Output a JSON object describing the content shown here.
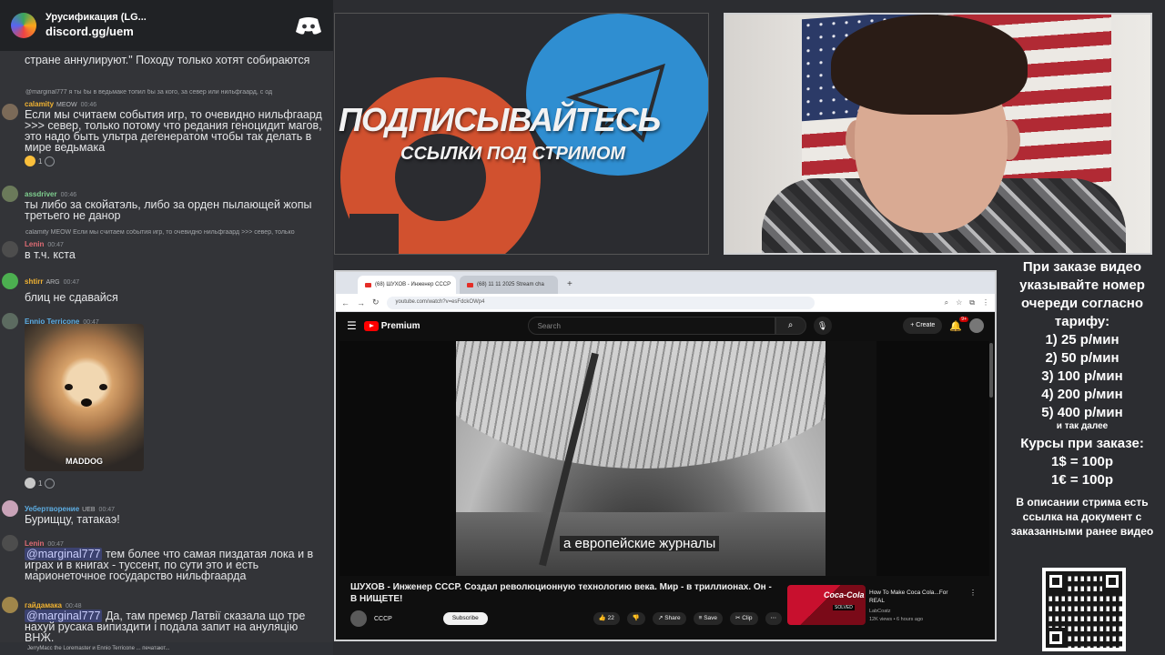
{
  "discord": {
    "server_name": "Урусификация (LG...",
    "invite": "discord.gg/uem",
    "messages": [
      {
        "text": "стране аннулируют.\" Походу только хотят собираются"
      },
      {
        "reply": "@marginal777 я ты бы в ведьмаке топил бы за кого, за север или нильфгаард, с од",
        "user": "calamity",
        "badge": "MEOW",
        "time": "00:46",
        "text": "Если мы считаем события игр, то очевидно нильфгаард >>> север, только потому что редания геноцидит магов, это надо быть ультра дегенератом чтобы так делать в мире ведьмака",
        "reaction": "1"
      },
      {
        "user": "assdriver",
        "time": "00:46",
        "text": "ты либо за скойатэль, либо за орден пылающей жопы третьего не данор"
      },
      {
        "reply": "calamity MEOW Если мы считаем события игр, то очевидно нильфгаард >>> север, только",
        "user": "Lenin",
        "time": "00:47",
        "text": "в т.ч. кста"
      },
      {
        "user": "shtirr",
        "badge": "ARG",
        "time": "00:47",
        "text": "блиц не сдавайся"
      },
      {
        "user": "Ennio Terricone",
        "time": "00:47",
        "caption": "MADDOG",
        "reaction": "1"
      },
      {
        "user": "Уебертворение",
        "badge": "UEB",
        "time": "00:47",
        "text": "Бурищцу, татакаэ!"
      },
      {
        "user": "Lenin",
        "time": "00:47",
        "mention": "@marginal777",
        "text": " тем более что самая пиздатая лока и в играх и в книгах - туссент, по сути это и есть марионеточное государство нильфгаарда"
      },
      {
        "user": "гайдамака",
        "time": "00:48",
        "mention": "@marginal777",
        "text": " Да, там премєр Латвії сказала що тре нахуй русака випиздити і подала запит на ануляцію ВНЖ."
      }
    ],
    "typing": "JerryMacc the Loremaster и Ennio Terricone ... печатают..."
  },
  "banner": {
    "title": "ПОДПИСЫВАЙТЕСЬ",
    "subtitle": "ССЫЛКИ ПОД СТРИМОМ"
  },
  "browser": {
    "tabs": [
      {
        "label": "(68) ШУХОВ - Инженер СССР"
      },
      {
        "label": "(68) 11 11 2025 Stream cha"
      }
    ],
    "new_tab": "+",
    "url": "youtube.com/watch?v=esFdckOWp4"
  },
  "youtube": {
    "logo": "Premium",
    "search_placeholder": "Search",
    "create": "Create",
    "notifications": "9+",
    "subtitle": "а европейские журналы",
    "video_title": "ШУХОВ - Инженер СССР. Создал революционную технологию века. Мир - в триллионах. Он - В НИЩЕТЕ!",
    "channel": "СССР",
    "subscribe": "Subscribe",
    "likes": "22",
    "share": "Share",
    "save": "Save",
    "clip": "Clip",
    "rec": {
      "thumb_text": "Coca-Cola",
      "thumb_badge": "SOLVED",
      "title": "How To Make Coca Cola...For REAL",
      "channel": "LabCoatz",
      "meta": "12K views • 6 hours ago"
    }
  },
  "info": {
    "intro": "При заказе видео указывайте номер очереди согласно тарифу:",
    "prices": [
      "1) 25 р/мин",
      "2) 50 р/мин",
      "3) 100 р/мин",
      "4) 200 р/мин",
      "5) 400 р/мин"
    ],
    "etc": "и так далее",
    "rates_heading": "Курсы при заказе:",
    "rates": [
      "1$ = 100р",
      "1€ = 100р"
    ],
    "description": "В описании стрима есть ссылка на документ с заказанными ранее видео"
  },
  "colors": {
    "discord_bg": "#333438",
    "telegram_blue": "#2f8ed1",
    "patreon_orange": "#d1512f",
    "youtube_red": "#ff0000"
  }
}
